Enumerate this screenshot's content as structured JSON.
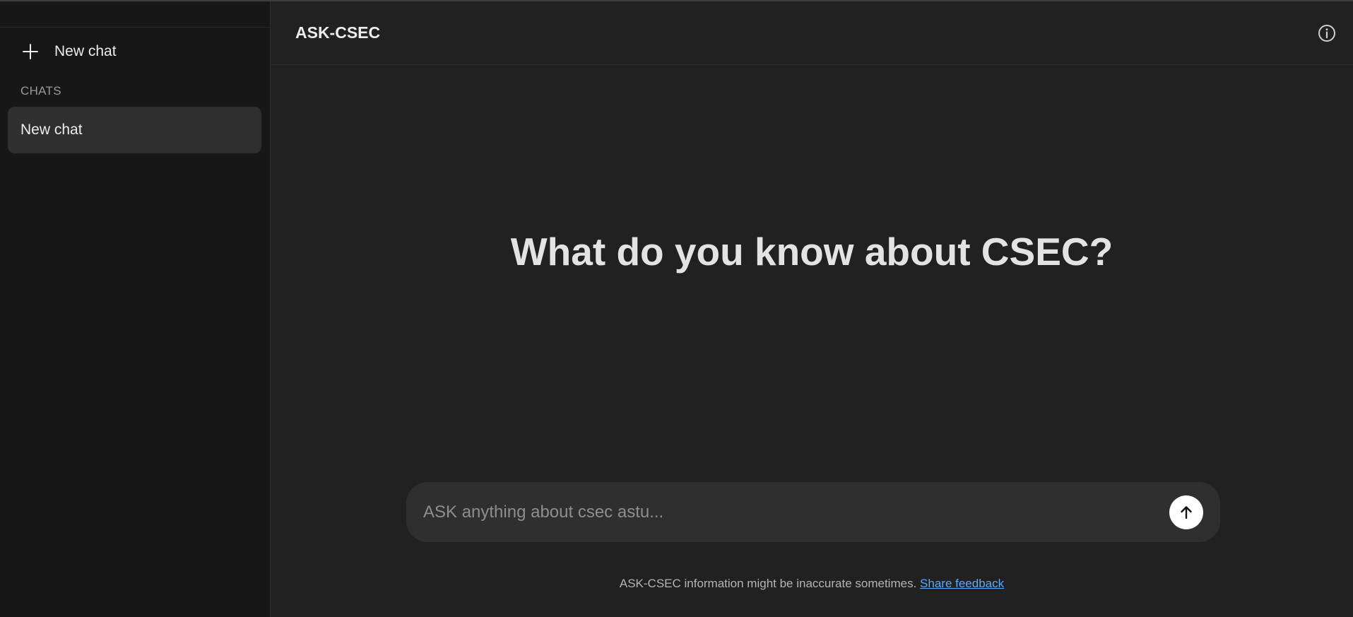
{
  "sidebar": {
    "new_chat_label": "New chat",
    "section_label": "CHATS",
    "chats": [
      {
        "label": "New chat",
        "active": true
      }
    ]
  },
  "header": {
    "title": "ASK-CSEC",
    "info_icon": "info-circle-icon"
  },
  "main": {
    "hero_text": "What do you know about CSEC?",
    "composer": {
      "placeholder": "ASK anything about csec astu...",
      "value": "",
      "send_icon": "arrow-up-icon"
    },
    "footer": {
      "note": "ASK-CSEC information might be inaccurate sometimes.",
      "link_label": "Share feedback"
    }
  },
  "colors": {
    "sidebar_bg": "#171717",
    "main_bg": "#212121",
    "active_chat_bg": "#2f2f2f",
    "link": "#5aa8ff"
  }
}
